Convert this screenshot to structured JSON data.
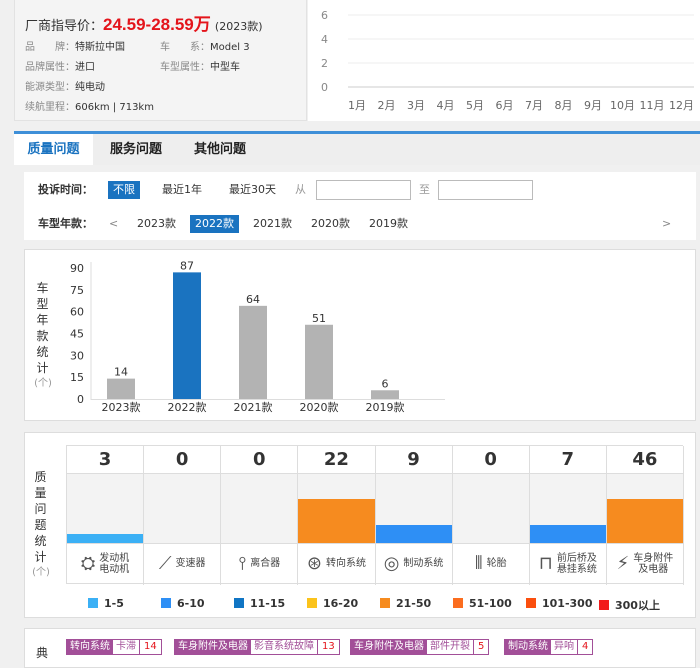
{
  "info": {
    "price_label": "厂商指导价：",
    "price": "24.59-28.59万",
    "price_year": "(2023款)",
    "rows": [
      {
        "label": "品　　牌：",
        "value": "特斯拉中国"
      },
      {
        "label": "车　　系：",
        "value": "Model 3"
      },
      {
        "label": "品牌属性：",
        "value": "进口"
      },
      {
        "label": "车型属性：",
        "value": "中型车"
      },
      {
        "label": "能源类型：",
        "value": "纯电动"
      },
      {
        "label": "续航里程：",
        "value": "606km | 713km"
      }
    ]
  },
  "trend": {
    "y_ticks": [
      "6",
      "4",
      "2",
      "0"
    ],
    "months": [
      "1月",
      "2月",
      "3月",
      "4月",
      "5月",
      "6月",
      "7月",
      "8月",
      "9月",
      "10月",
      "11月",
      "12月"
    ]
  },
  "tabs": [
    "质量问题",
    "服务问题",
    "其他问题"
  ],
  "filter": {
    "time_label": "投诉时间：",
    "time_options": [
      "不限",
      "最近1年",
      "最近30天"
    ],
    "from": "从",
    "to": "至",
    "from_value": "",
    "to_value": "",
    "year_label": "车型年款：",
    "prev": "<",
    "next": ">",
    "years": [
      "2023款",
      "2022款",
      "2021款",
      "2020款",
      "2019款"
    ],
    "selected_year": "2022款"
  },
  "chart_data": {
    "type": "bar",
    "title": "车型年款统计",
    "ylabel": "车型年款统计",
    "unit": "(个)",
    "categories": [
      "2023款",
      "2022款",
      "2021款",
      "2020款",
      "2019款"
    ],
    "values": [
      14,
      87,
      64,
      51,
      6
    ],
    "ylim": [
      0,
      90
    ],
    "y_ticks": [
      "90",
      "75",
      "60",
      "45",
      "30",
      "15",
      "0"
    ],
    "highlight": "2022款",
    "colors": {
      "bar": "#b3b3b3",
      "highlight": "#1a73c0"
    }
  },
  "quality": {
    "title": "质量问题统计",
    "unit": "(个)",
    "items": [
      {
        "name": "发动机\n电动机",
        "lines": [
          "发动机",
          "电动机"
        ],
        "count": "3",
        "value": 3,
        "color": "#3bb0f5",
        "icon": "engine-icon"
      },
      {
        "lines": [
          "变速器"
        ],
        "count": "0",
        "value": 0,
        "color": "",
        "icon": "gearshift-icon"
      },
      {
        "lines": [
          "离合器"
        ],
        "count": "0",
        "value": 0,
        "color": "",
        "icon": "clutch-icon"
      },
      {
        "lines": [
          "转向系统"
        ],
        "count": "22",
        "value": 22,
        "color": "#f68b1f",
        "icon": "steering-wheel-icon"
      },
      {
        "lines": [
          "制动系统"
        ],
        "count": "9",
        "value": 9,
        "color": "#2e8ff5",
        "icon": "brake-disc-icon"
      },
      {
        "lines": [
          "轮胎"
        ],
        "count": "0",
        "value": 0,
        "color": "",
        "icon": "tire-icon"
      },
      {
        "lines": [
          "前后桥及",
          "悬挂系统"
        ],
        "count": "7",
        "value": 7,
        "color": "#2e8ff5",
        "icon": "axle-icon"
      },
      {
        "lines": [
          "车身附件",
          "及电器"
        ],
        "count": "46",
        "value": 46,
        "color": "#f68b1f",
        "icon": "battery-icon"
      }
    ],
    "legend": [
      {
        "label": "1-5",
        "color": "#3bb0f5"
      },
      {
        "label": "6-10",
        "color": "#2e8ff5"
      },
      {
        "label": "11-15",
        "color": "#1075c4"
      },
      {
        "label": "16-20",
        "color": "#fbc31b"
      },
      {
        "label": "21-50",
        "color": "#f68b1f"
      },
      {
        "label": "51-100",
        "color": "#fb6d1f"
      },
      {
        "label": "101-300",
        "color": "#fb4f0e"
      },
      {
        "label": "300以上",
        "color": "#f21b1b"
      }
    ]
  },
  "typical": {
    "title": "典",
    "tags": [
      {
        "a": "转向系统",
        "b": "卡滞",
        "c": "14"
      },
      {
        "a": "车身附件及电器",
        "b": "影音系统故障",
        "c": "13"
      },
      {
        "a": "车身附件及电器",
        "b": "部件开裂",
        "c": "5"
      },
      {
        "a": "制动系统",
        "b": "异响",
        "c": "4"
      }
    ]
  }
}
